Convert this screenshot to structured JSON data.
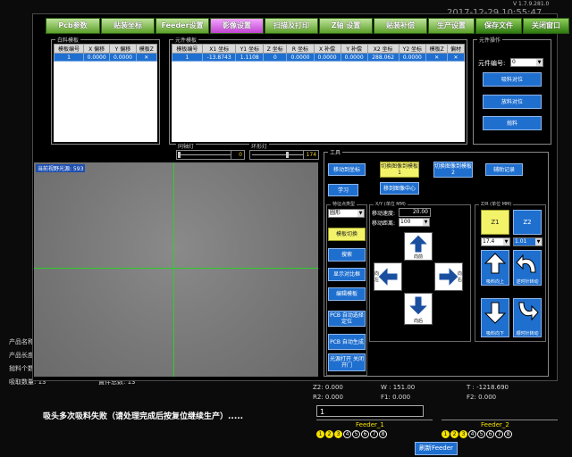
{
  "version": "V 1.7.9.281.0",
  "clock": "2017-12-29 10:55:47",
  "tabs": [
    "Pcb参数",
    "贴装坐标",
    "Feeder设置",
    "影像设置",
    "扫描及打印",
    "Z轴 设置",
    "贴装补偿",
    "生产设置",
    "保存文件",
    "关闭窗口"
  ],
  "left_table": {
    "title": "白料模板",
    "headers": [
      "模板编号",
      "X 偏移",
      "Y 偏移",
      "模板Z"
    ],
    "rows": [
      [
        "1",
        "0.0000",
        "0.0000",
        "✕"
      ]
    ]
  },
  "mid_table": {
    "title": "元件模板",
    "headers": [
      "模板编号",
      "X1 坐标",
      "Y1 坐标",
      "Z 坐标",
      "R 坐标",
      "X 补偿",
      "Y 补偿",
      "X2 坐标",
      "Y2 坐标",
      "模板Z",
      "偏材"
    ],
    "rows": [
      [
        "1",
        "-13.8743",
        "1.1108",
        "0",
        "0.0000",
        "0.0000",
        "0.0000",
        "288.062",
        "0.0000",
        "✕",
        "✕"
      ]
    ]
  },
  "component": {
    "title": "元件操作",
    "number_label": "元件编号:",
    "number_value": "0",
    "buttons": [
      "吸料对位",
      "放料对位",
      "抛料"
    ]
  },
  "light1": {
    "title": "同轴灯",
    "value": "0"
  },
  "light2": {
    "title": "环形灯",
    "value": "174"
  },
  "camera": {
    "label": "当前视野光源: 593"
  },
  "tools": {
    "title": "工具",
    "btn_move": "移动到坐标",
    "btn_cut1": "切换图像到模板1",
    "btn_cut2": "切换图像到模板2",
    "btn_aux": "辅助记录",
    "btn_learn": "学习",
    "btn_center": "移到图像中心",
    "feature_title": "特征点类型",
    "feature_value": "圆形",
    "btn_switch": "模板切换",
    "btn_search": "搜索",
    "btn_show": "显示对比框",
    "btn_edit": "编辑模板",
    "btn_pcb": "PCB 自动选择定位",
    "btn_pcb2": "PCB 自动生成",
    "btn_light": "光源打开 关闭开门"
  },
  "xy": {
    "title": "X/Y (单位 MM)",
    "speed_label": "移动速度:",
    "speed_value": "20.00",
    "dist_label": "移动距离:",
    "dist_value": "100",
    "up": "向前",
    "down": "向后",
    "left": "向左",
    "right": "向右"
  },
  "z": {
    "title": "Z/R (单位 MM)",
    "z1": "Z1",
    "z2": "Z2",
    "v1": "17.4",
    "v2": "1.01",
    "up": "吸料向上",
    "down": "吸料向下",
    "rot1": "逆时针转动",
    "rot2": "顺时针转动"
  },
  "background": {
    "prod_name": "产品名称",
    "prod_len": "产品长度",
    "throw_count": "抛料个数",
    "suck_count": "吸取数量: 13",
    "place_total": "置件总数: 13",
    "error": "吸头多次吸料失败（请处理完成后按复位继续生产）.....",
    "z2": "Z2: 0.000",
    "w": "W : 151.00",
    "t": "T : -1218.690",
    "r2": "R2: 0.000",
    "f1": "F1: 0.000",
    "f2": "F2: 0.000",
    "input": "1",
    "feeder1": "Feeder_1",
    "feeder2": "Feeder_2",
    "refresh": "刷新Feeder"
  }
}
